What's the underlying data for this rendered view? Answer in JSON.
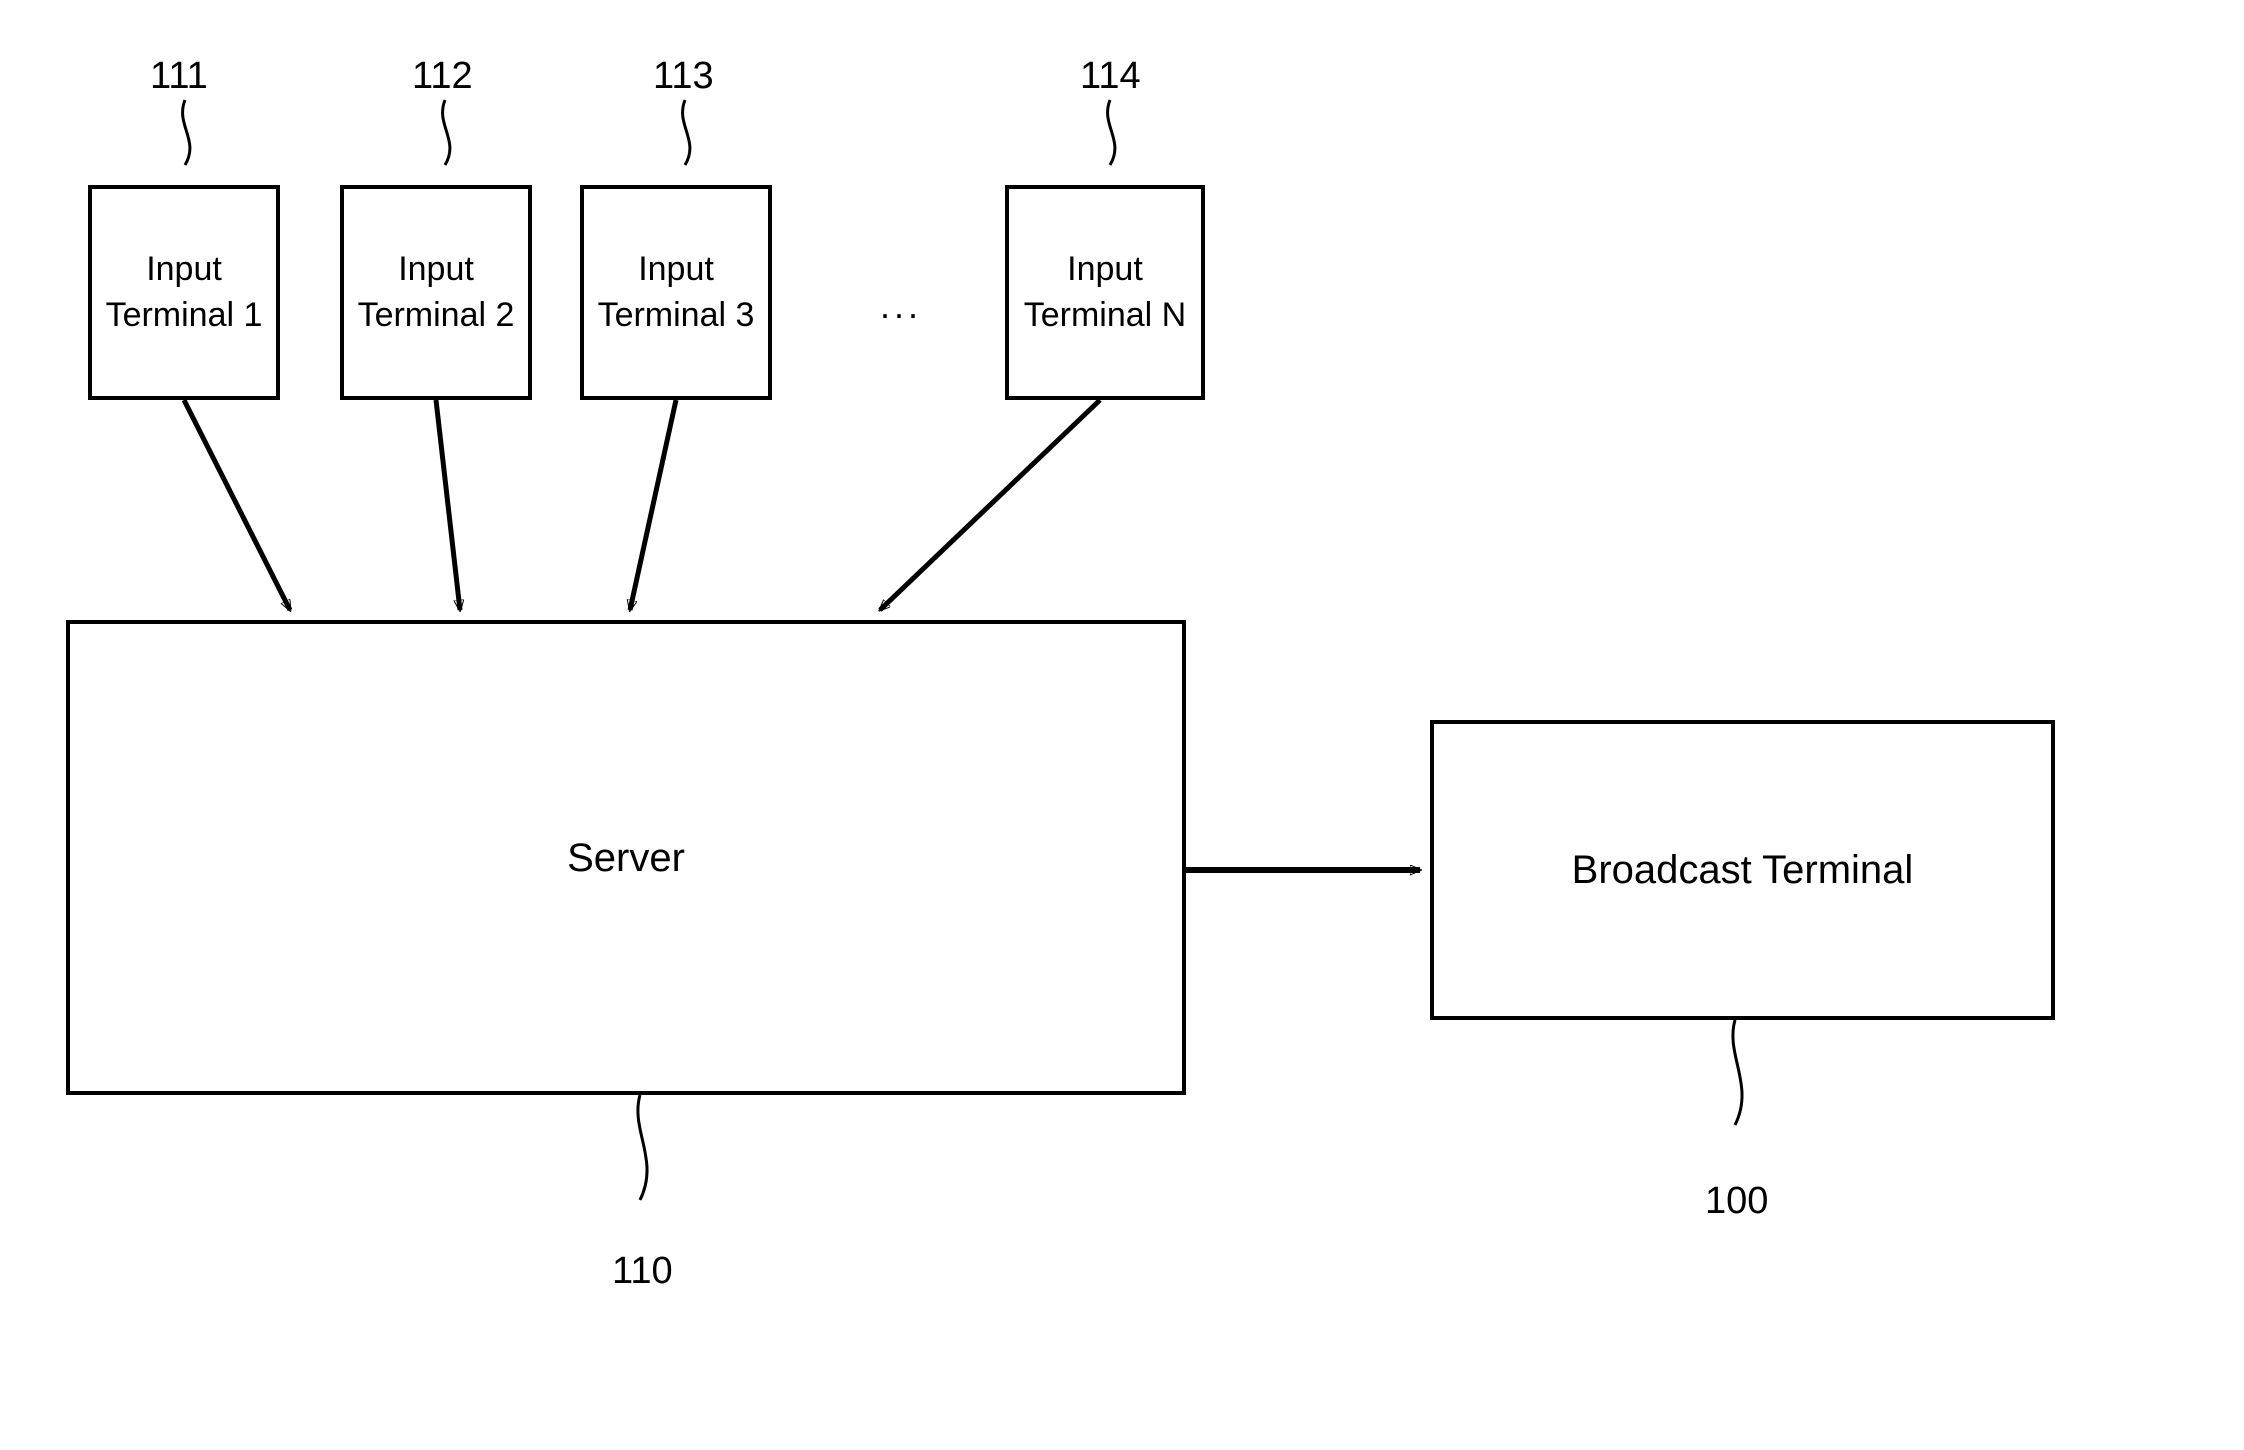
{
  "refs": {
    "t1": "111",
    "t2": "112",
    "t3": "113",
    "t4": "114",
    "server": "110",
    "broadcast": "100"
  },
  "boxes": {
    "t1": "Input\nTerminal 1",
    "t2": "Input\nTerminal 2",
    "t3": "Input\nTerminal 3",
    "t4": "Input\nTerminal N",
    "server": "Server",
    "broadcast": "Broadcast Terminal"
  },
  "misc": {
    "ellipsis": "..."
  }
}
